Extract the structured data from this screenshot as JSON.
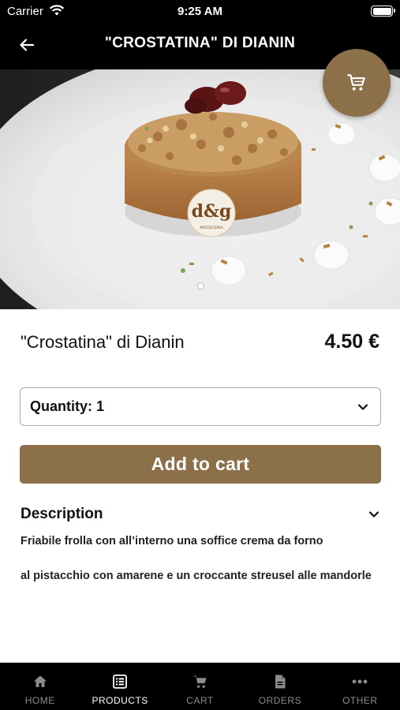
{
  "status_bar": {
    "carrier": "Carrier",
    "time": "9:25 AM"
  },
  "header": {
    "title": "\"CROSTATINA\" DI DIANIN"
  },
  "hero": {
    "logo_text": "d&g",
    "logo_subtext": "PASTICCERIA"
  },
  "product": {
    "name": "\"Crostatina\" di Dianin",
    "price": "4.50 €"
  },
  "quantity": {
    "label": "Quantity: 1",
    "selected": 1
  },
  "add_to_cart": {
    "label": "Add to cart"
  },
  "description": {
    "heading": "Description",
    "paragraphs": [
      "Friabile frolla con all’interno una soffice crema da forno",
      "al pistacchio con amarene e un croccante streusel alle mandorle"
    ]
  },
  "tabs": [
    {
      "label": "HOME",
      "icon": "home-icon",
      "active": false
    },
    {
      "label": "PRODUCTS",
      "icon": "list-icon",
      "active": true
    },
    {
      "label": "CART",
      "icon": "cart-icon",
      "active": false
    },
    {
      "label": "ORDERS",
      "icon": "document-icon",
      "active": false
    },
    {
      "label": "OTHER",
      "icon": "more-icon",
      "active": false
    }
  ],
  "colors": {
    "accent": "#8b7049",
    "bar": "#000000",
    "inactive_tab": "#8c8c8c"
  }
}
